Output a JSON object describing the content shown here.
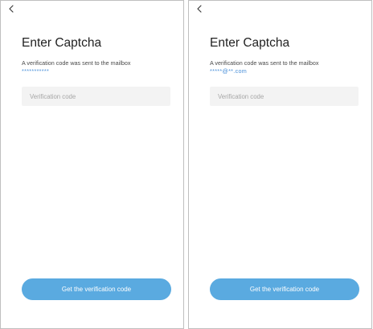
{
  "screens": [
    {
      "title": "Enter Captcha",
      "subtitle": "A verification code was sent to the mailbox",
      "masked_email": "***********",
      "input_placeholder": "Verification code",
      "button_label": "Get the verification code"
    },
    {
      "title": "Enter Captcha",
      "subtitle": "A verification code was sent to the mailbox",
      "masked_email": "*****@**.com",
      "input_placeholder": "Verification code",
      "button_label": "Get the verification code"
    }
  ],
  "icons": {
    "back": "chevron-left-icon"
  },
  "colors": {
    "accent": "#5aaae0",
    "masked_text": "#4a90d9",
    "input_background": "#f3f3f3"
  }
}
